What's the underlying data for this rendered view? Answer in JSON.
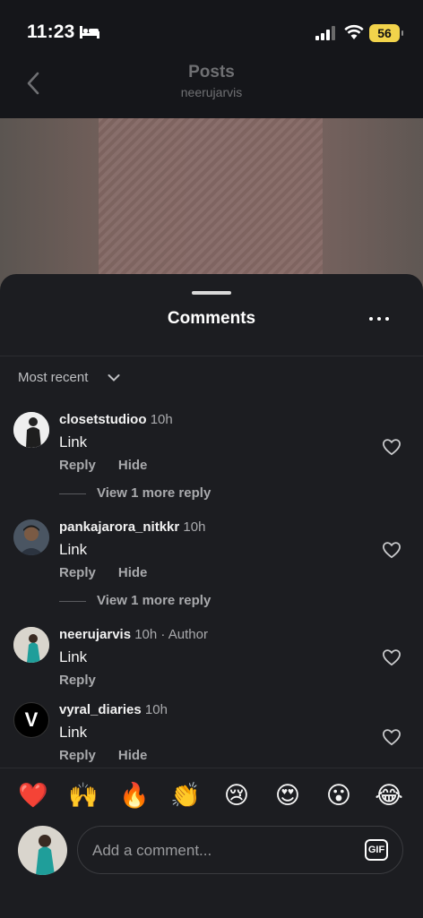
{
  "status_bar": {
    "time": "11:23",
    "battery": "56"
  },
  "header": {
    "title": "Posts",
    "subtitle": "neerujarvis"
  },
  "sheet": {
    "title": "Comments",
    "sort_label": "Most recent"
  },
  "comments": [
    {
      "username": "closetstudioo",
      "meta": "10h",
      "text": "Link",
      "reply": "Reply",
      "hide": "Hide",
      "view_more": "View 1 more reply"
    },
    {
      "username": "pankajarora_nitkkr",
      "meta": "10h",
      "text": "Link",
      "reply": "Reply",
      "hide": "Hide",
      "view_more": "View 1 more reply"
    },
    {
      "username": "neerujarvis",
      "meta": "10h · Author",
      "text": "Link",
      "reply": "Reply"
    },
    {
      "username": "vyral_diaries",
      "meta": "10h",
      "text": "Link",
      "reply": "Reply",
      "hide": "Hide",
      "avatar_letter": "V"
    }
  ],
  "emoji_bar": [
    "❤️",
    "🙌",
    "🔥",
    "👏",
    "😢",
    "😍",
    "😮",
    "😂"
  ],
  "composer": {
    "placeholder": "Add a comment...",
    "gif_label": "GIF"
  },
  "colors": {
    "background": "#1c1d21",
    "text_secondary": "#a9aaad",
    "battery": "#f2d34b"
  }
}
